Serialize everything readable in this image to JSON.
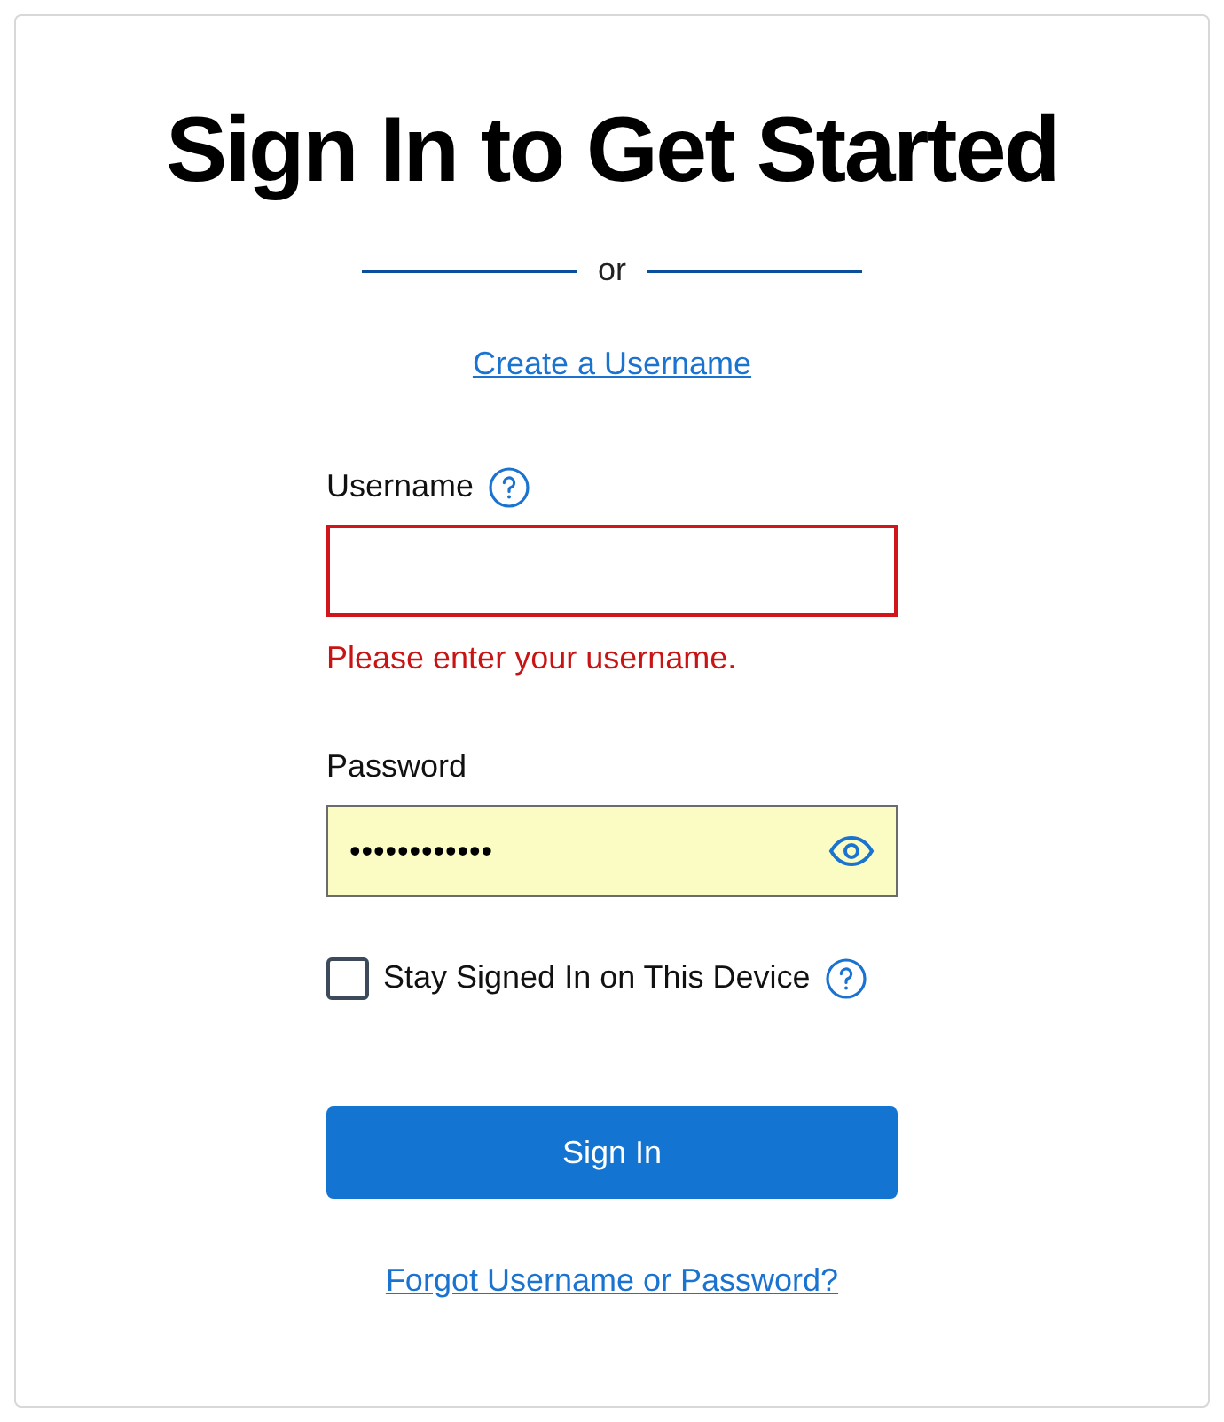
{
  "title": "Sign In to Get Started",
  "divider_text": "or",
  "create_link": "Create a Username",
  "username": {
    "label": "Username",
    "invalid": true,
    "error": "Please enter your username."
  },
  "password": {
    "label": "Password",
    "value": "••••••••••••",
    "autofilled": true
  },
  "stay_signed_in": {
    "label": "Stay Signed In on This Device",
    "checked": false
  },
  "submit": "Sign In",
  "forgot_link": "Forgot Username or Password?"
}
